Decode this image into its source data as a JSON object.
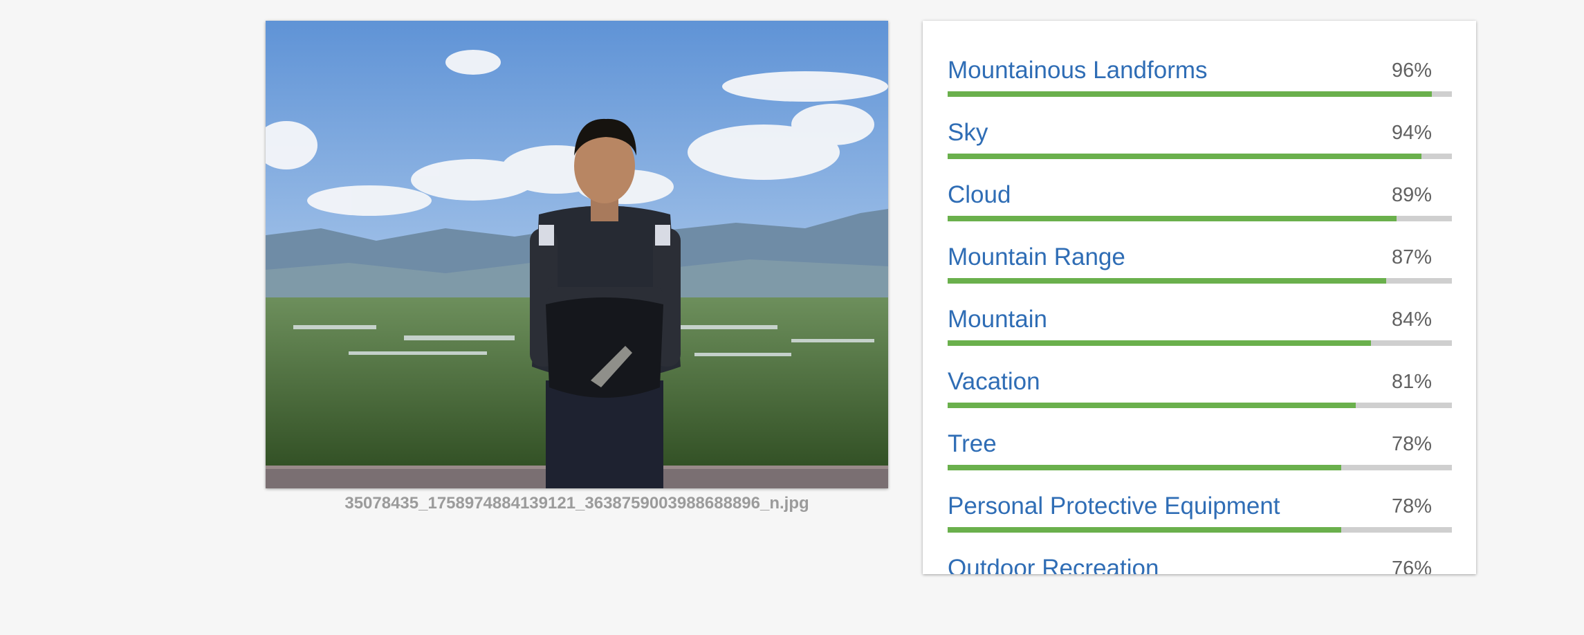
{
  "photo": {
    "filename": "35078435_1758974884139121_3638759003988688896_n.jpg"
  },
  "labels": [
    {
      "name": "Mountainous Landforms",
      "score": "96%",
      "fraction": 0.96
    },
    {
      "name": "Sky",
      "score": "94%",
      "fraction": 0.94
    },
    {
      "name": "Cloud",
      "score": "89%",
      "fraction": 0.89
    },
    {
      "name": "Mountain Range",
      "score": "87%",
      "fraction": 0.87
    },
    {
      "name": "Mountain",
      "score": "84%",
      "fraction": 0.84
    },
    {
      "name": "Vacation",
      "score": "81%",
      "fraction": 0.81
    },
    {
      "name": "Tree",
      "score": "78%",
      "fraction": 0.78
    },
    {
      "name": "Personal Protective Equipment",
      "score": "78%",
      "fraction": 0.78
    },
    {
      "name": "Outdoor Recreation",
      "score": "76%",
      "fraction": 0.76
    }
  ],
  "colors": {
    "label_text": "#2f6db5",
    "bar_fill": "#6ab04c",
    "bar_track": "#cfcfcf"
  }
}
